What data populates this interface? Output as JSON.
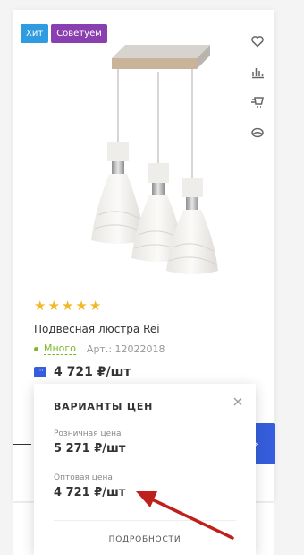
{
  "badges": [
    "Хит",
    "Советуем"
  ],
  "action_icons": [
    "heart-icon",
    "compare-icon",
    "cart-fast-icon",
    "view-icon"
  ],
  "rating": {
    "stars": 5
  },
  "product": {
    "title": "Подвесная люстра Rei",
    "stock": "Много",
    "article": "Арт.: 12022018",
    "price": "4 721 ₽/шт",
    "more_label": "···"
  },
  "popup": {
    "title": "ВАРИАНТЫ ЦЕН",
    "retail_label": "Розничная цена",
    "retail_price": "5 271 ₽/шт",
    "wholesale_label": "Оптовая цена",
    "wholesale_price": "4 721 ₽/шт",
    "details": "ПОДРОБНОСТИ"
  },
  "colors": {
    "accent": "#365edc",
    "stock": "#7db829",
    "star": "#f0b928",
    "hit": "#2f9be0",
    "recommend": "#8a3fb0",
    "arrow": "#c0201c"
  }
}
